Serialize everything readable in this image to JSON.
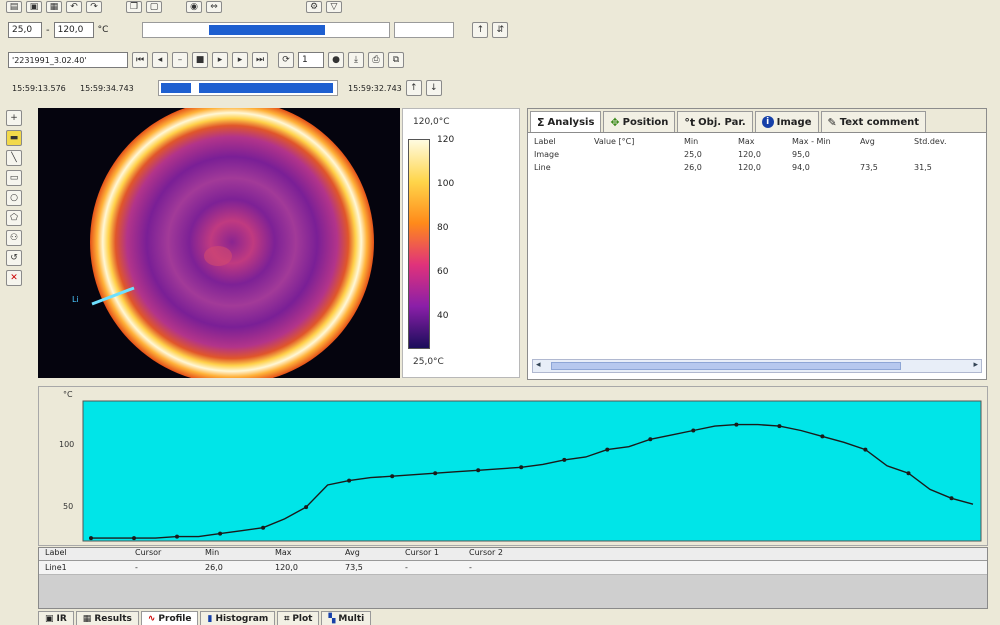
{
  "toolbar": {
    "row1_icons": [
      "open-icon",
      "save-icon",
      "print-icon",
      "undo-icon",
      "redo-icon",
      "copy-icon",
      "paste-icon",
      "camera-icon",
      "measure-icon",
      "settings-icon",
      "filter-icon"
    ],
    "range_min": "25,0",
    "range_max": "120,0",
    "range_unit": "°C",
    "file_label": "'2231991_3.02.40'",
    "time_start": "15:59:13.576",
    "time_end": "15:59:34.743",
    "time_current": "15:59:32.743",
    "zoom_value": "1"
  },
  "scale": {
    "top_label": "120,0°C",
    "bottom_label": "25,0°C",
    "ticks": [
      "120",
      "100",
      "80",
      "60",
      "40"
    ]
  },
  "analysis": {
    "tabs": [
      {
        "label": "Analysis",
        "icon": "analysis-icon"
      },
      {
        "label": "Position",
        "icon": "position-icon"
      },
      {
        "label": "Obj. Par.",
        "icon": "object-params-icon"
      },
      {
        "label": "Image",
        "icon": "info-icon"
      },
      {
        "label": "Text comment",
        "icon": "comment-icon"
      }
    ],
    "columns": [
      "Label",
      "Value [°C]",
      "Min",
      "Max",
      "Max - Min",
      "Avg",
      "Std.dev."
    ],
    "rows": [
      [
        "Image",
        "",
        "25,0",
        "120,0",
        "95,0",
        "",
        ""
      ],
      [
        "Line",
        "",
        "26,0",
        "120,0",
        "94,0",
        "73,5",
        "31,5"
      ]
    ]
  },
  "profile": {
    "y_unit": "°C",
    "y_ticks": [
      "100",
      "50"
    ],
    "line_color": "#1a1a1a",
    "bg_color": "#00e5e8"
  },
  "chart_data": {
    "type": "line",
    "x": [
      1,
      2,
      3,
      4,
      5,
      6,
      7,
      8,
      9,
      10,
      11,
      12,
      13,
      14,
      15,
      16,
      17,
      18,
      19,
      20,
      21,
      22,
      23,
      24,
      25,
      26,
      27,
      28,
      29,
      30,
      31,
      32,
      33,
      34,
      35,
      36,
      37,
      38,
      39,
      40,
      41,
      42
    ],
    "series": [
      {
        "values": [
          27,
          27,
          27,
          27,
          28,
          28,
          30,
          32,
          34,
          40,
          48,
          63,
          66,
          68,
          69,
          70,
          71,
          72,
          73,
          74,
          75,
          77,
          80,
          82,
          87,
          89,
          94,
          97,
          100,
          103,
          104,
          104,
          103,
          100,
          96,
          92,
          87,
          76,
          71,
          60,
          54,
          50
        ]
      }
    ],
    "ylim": [
      25,
      120
    ],
    "xlabel": "",
    "ylabel": "°C",
    "grid": false
  },
  "lower_table": {
    "columns": [
      "Label",
      "Cursor",
      "Min",
      "Max",
      "Avg",
      "Cursor 1",
      "Cursor 2"
    ],
    "rows": [
      [
        "Line1",
        "-",
        "26,0",
        "120,0",
        "73,5",
        "-",
        "-"
      ]
    ]
  },
  "bottom_tabs": [
    {
      "label": "IR",
      "icon": "ir-icon"
    },
    {
      "label": "Results",
      "icon": "results-icon"
    },
    {
      "label": "Profile",
      "icon": "profile-icon"
    },
    {
      "label": "Histogram",
      "icon": "histogram-icon"
    },
    {
      "label": "Plot",
      "icon": "plot-icon"
    },
    {
      "label": "Multi",
      "icon": "multi-icon"
    }
  ]
}
